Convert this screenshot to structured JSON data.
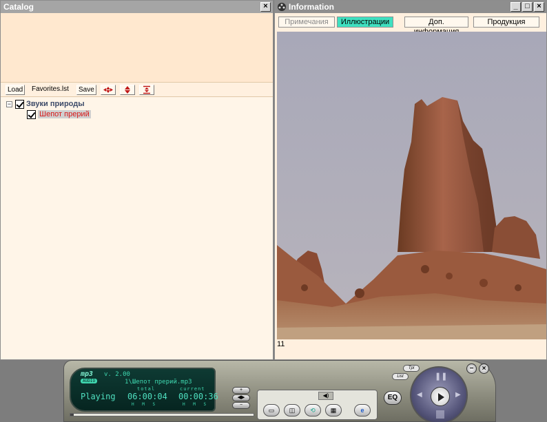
{
  "catalog": {
    "title": "Catalog",
    "close": "×",
    "toolbar": {
      "load": "Load",
      "file": "Favorites.lst",
      "save": "Save"
    },
    "tree": {
      "expander": "−",
      "root": "Звуки природы",
      "child": "Шепот прерий"
    }
  },
  "info": {
    "title": "Information",
    "buttons": {
      "minimize": "_",
      "maximize": "□",
      "close": "×"
    },
    "tabs": [
      {
        "label": "Примечания"
      },
      {
        "label": "Иллюстрации"
      },
      {
        "label": "Доп. информация"
      },
      {
        "label": "Продукция"
      }
    ],
    "caption": "11"
  },
  "player": {
    "logo": "mp3",
    "audio": "AUDIO",
    "version": "v. 2.00",
    "track": "1\\Шепот прерий.mp3",
    "status": "Playing",
    "total_label": "total",
    "total": "06:00:04",
    "current_label": "current",
    "current": "00:00:36",
    "hms": "H M S",
    "eq": "EQ",
    "tpl": "Tpl",
    "list": "List",
    "progress": 0.02
  },
  "colors": {
    "active_tab": "#3fe0c0",
    "child_node": "#d81818",
    "lcd_text": "#3fd8b0"
  }
}
